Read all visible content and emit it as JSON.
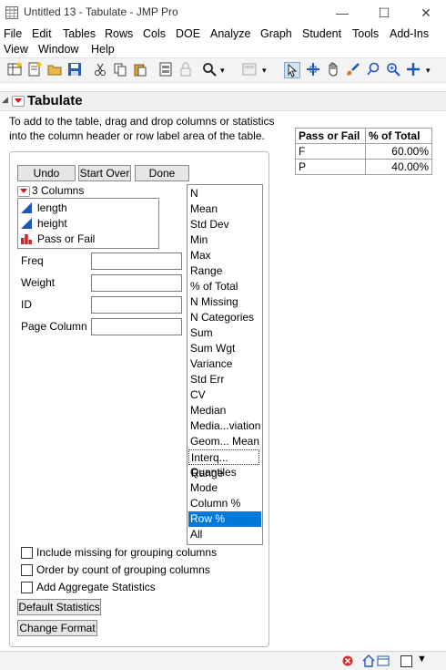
{
  "window": {
    "title": "Untitled 13 - Tabulate - JMP Pro",
    "minimize": "—",
    "maximize": "☐",
    "close": "✕"
  },
  "menu": {
    "row1": [
      "File",
      "Edit",
      "Tables",
      "Rows",
      "Cols",
      "DOE",
      "Analyze",
      "Graph",
      "Student",
      "Tools",
      "Add-Ins"
    ],
    "row2": [
      "View",
      "Window",
      "Help"
    ]
  },
  "report": {
    "heading": "Tabulate",
    "instructions_line1": "To add to the table, drag and drop columns or statistics",
    "instructions_line2": "into the column header or row label area of the table."
  },
  "result_table": {
    "headers": [
      "Pass or Fail",
      "% of Total"
    ],
    "rows": [
      {
        "label": "F",
        "value": "60.00%"
      },
      {
        "label": "P",
        "value": "40.00%"
      }
    ]
  },
  "panel": {
    "undo": "Undo",
    "start_over": "Start Over",
    "done": "Done",
    "columns_header": "3 Columns",
    "columns": [
      {
        "name": "length",
        "icon": "continuous-icon"
      },
      {
        "name": "height",
        "icon": "continuous-icon"
      },
      {
        "name": "Pass or Fail",
        "icon": "nominal-icon"
      }
    ],
    "roles": {
      "freq": "Freq",
      "weight": "Weight",
      "id": "ID",
      "page_column": "Page Column"
    },
    "statistics": [
      "N",
      "Mean",
      "Std Dev",
      "Min",
      "Max",
      "Range",
      "% of Total",
      "N Missing",
      "N Categories",
      "Sum",
      "Sum Wgt",
      "Variance",
      "Std Err",
      "CV",
      "Median",
      "Media...viation",
      "Geom... Mean",
      "Interq... Range",
      "Quantiles",
      "Mode",
      "Column %",
      "Row %",
      "All"
    ],
    "selected_statistic": "Row %",
    "checkboxes": {
      "include_missing": "Include missing for grouping columns",
      "order_by_count": "Order by count of grouping columns",
      "add_aggregate": "Add Aggregate Statistics"
    },
    "default_statistics": "Default Statistics",
    "change_format": "Change Format"
  },
  "colors": {
    "selection": "#0078d7",
    "continuous_icon": "#1f57b8",
    "nominal_icon": "#c62828",
    "red_triangle": "#dd1111"
  }
}
